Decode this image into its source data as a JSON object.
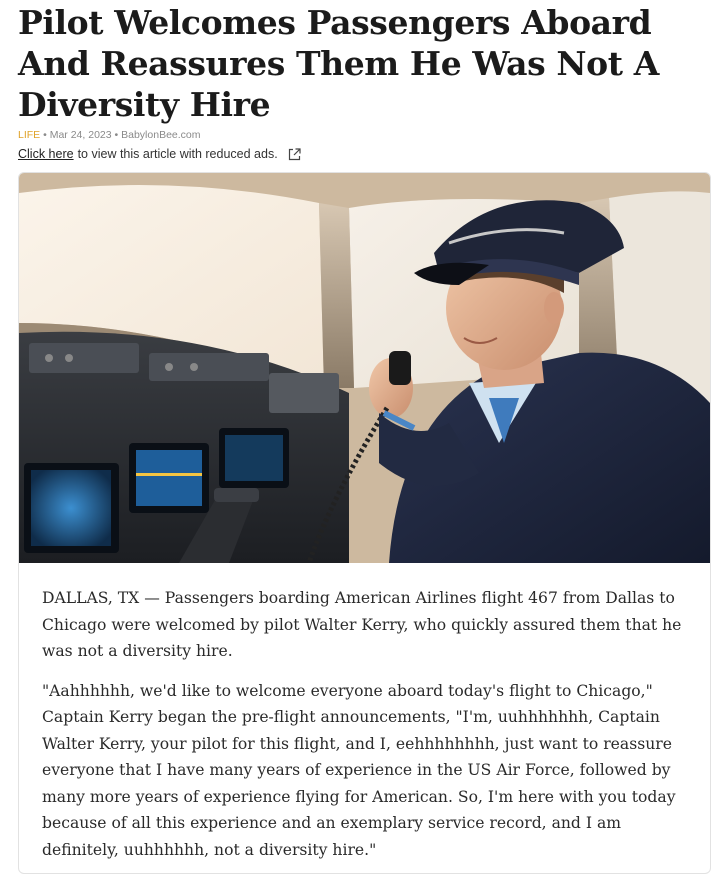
{
  "article": {
    "headline": "Pilot Welcomes Passengers Aboard And Reassures Them He Was Not A Diversity Hire",
    "category": "LIFE",
    "separator": "•",
    "date": "Mar 24, 2023",
    "source": "BabylonBee.com",
    "reduced_ads_link": "Click here",
    "reduced_ads_text": "to view this article with reduced ads.",
    "paragraphs": [
      "DALLAS, TX — Passengers boarding American Airlines flight 467 from Dallas to Chicago were welcomed by pilot Walter Kerry, who quickly assured them that he was not a diversity hire.",
      "\"Aahhhhhh, we'd like to welcome everyone aboard today's flight to Chicago,\" Captain Kerry began the pre-flight announcements, \"I'm, uuhhhhhhh, Captain Walter Kerry, your pilot for this flight, and I, eehhhhhhhh, just want to reassure everyone that I have many years of experience in the US Air Force, followed by many more years of experience flying for American. So, I'm here with you today because of all this experience and an exemplary service record, and I am definitely, uuhhhhhh, not a diversity hire.\""
    ]
  },
  "icons": {
    "external_link": "external-link-icon"
  }
}
